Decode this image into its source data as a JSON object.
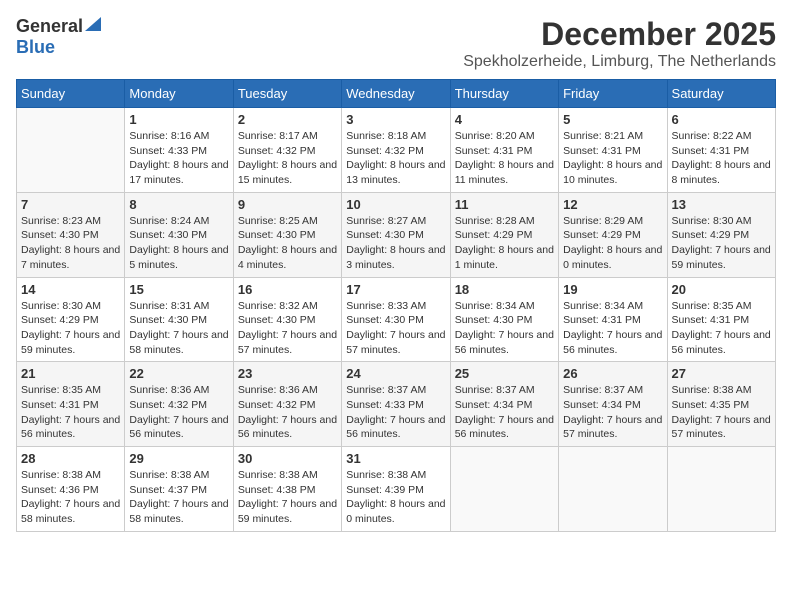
{
  "logo": {
    "general": "General",
    "blue": "Blue"
  },
  "title": "December 2025",
  "location": "Spekholzerheide, Limburg, The Netherlands",
  "weekdays": [
    "Sunday",
    "Monday",
    "Tuesday",
    "Wednesday",
    "Thursday",
    "Friday",
    "Saturday"
  ],
  "weeks": [
    [
      {
        "day": "",
        "sunrise": "",
        "sunset": "",
        "daylight": ""
      },
      {
        "day": "1",
        "sunrise": "Sunrise: 8:16 AM",
        "sunset": "Sunset: 4:33 PM",
        "daylight": "Daylight: 8 hours and 17 minutes."
      },
      {
        "day": "2",
        "sunrise": "Sunrise: 8:17 AM",
        "sunset": "Sunset: 4:32 PM",
        "daylight": "Daylight: 8 hours and 15 minutes."
      },
      {
        "day": "3",
        "sunrise": "Sunrise: 8:18 AM",
        "sunset": "Sunset: 4:32 PM",
        "daylight": "Daylight: 8 hours and 13 minutes."
      },
      {
        "day": "4",
        "sunrise": "Sunrise: 8:20 AM",
        "sunset": "Sunset: 4:31 PM",
        "daylight": "Daylight: 8 hours and 11 minutes."
      },
      {
        "day": "5",
        "sunrise": "Sunrise: 8:21 AM",
        "sunset": "Sunset: 4:31 PM",
        "daylight": "Daylight: 8 hours and 10 minutes."
      },
      {
        "day": "6",
        "sunrise": "Sunrise: 8:22 AM",
        "sunset": "Sunset: 4:31 PM",
        "daylight": "Daylight: 8 hours and 8 minutes."
      }
    ],
    [
      {
        "day": "7",
        "sunrise": "Sunrise: 8:23 AM",
        "sunset": "Sunset: 4:30 PM",
        "daylight": "Daylight: 8 hours and 7 minutes."
      },
      {
        "day": "8",
        "sunrise": "Sunrise: 8:24 AM",
        "sunset": "Sunset: 4:30 PM",
        "daylight": "Daylight: 8 hours and 5 minutes."
      },
      {
        "day": "9",
        "sunrise": "Sunrise: 8:25 AM",
        "sunset": "Sunset: 4:30 PM",
        "daylight": "Daylight: 8 hours and 4 minutes."
      },
      {
        "day": "10",
        "sunrise": "Sunrise: 8:27 AM",
        "sunset": "Sunset: 4:30 PM",
        "daylight": "Daylight: 8 hours and 3 minutes."
      },
      {
        "day": "11",
        "sunrise": "Sunrise: 8:28 AM",
        "sunset": "Sunset: 4:29 PM",
        "daylight": "Daylight: 8 hours and 1 minute."
      },
      {
        "day": "12",
        "sunrise": "Sunrise: 8:29 AM",
        "sunset": "Sunset: 4:29 PM",
        "daylight": "Daylight: 8 hours and 0 minutes."
      },
      {
        "day": "13",
        "sunrise": "Sunrise: 8:30 AM",
        "sunset": "Sunset: 4:29 PM",
        "daylight": "Daylight: 7 hours and 59 minutes."
      }
    ],
    [
      {
        "day": "14",
        "sunrise": "Sunrise: 8:30 AM",
        "sunset": "Sunset: 4:29 PM",
        "daylight": "Daylight: 7 hours and 59 minutes."
      },
      {
        "day": "15",
        "sunrise": "Sunrise: 8:31 AM",
        "sunset": "Sunset: 4:30 PM",
        "daylight": "Daylight: 7 hours and 58 minutes."
      },
      {
        "day": "16",
        "sunrise": "Sunrise: 8:32 AM",
        "sunset": "Sunset: 4:30 PM",
        "daylight": "Daylight: 7 hours and 57 minutes."
      },
      {
        "day": "17",
        "sunrise": "Sunrise: 8:33 AM",
        "sunset": "Sunset: 4:30 PM",
        "daylight": "Daylight: 7 hours and 57 minutes."
      },
      {
        "day": "18",
        "sunrise": "Sunrise: 8:34 AM",
        "sunset": "Sunset: 4:30 PM",
        "daylight": "Daylight: 7 hours and 56 minutes."
      },
      {
        "day": "19",
        "sunrise": "Sunrise: 8:34 AM",
        "sunset": "Sunset: 4:31 PM",
        "daylight": "Daylight: 7 hours and 56 minutes."
      },
      {
        "day": "20",
        "sunrise": "Sunrise: 8:35 AM",
        "sunset": "Sunset: 4:31 PM",
        "daylight": "Daylight: 7 hours and 56 minutes."
      }
    ],
    [
      {
        "day": "21",
        "sunrise": "Sunrise: 8:35 AM",
        "sunset": "Sunset: 4:31 PM",
        "daylight": "Daylight: 7 hours and 56 minutes."
      },
      {
        "day": "22",
        "sunrise": "Sunrise: 8:36 AM",
        "sunset": "Sunset: 4:32 PM",
        "daylight": "Daylight: 7 hours and 56 minutes."
      },
      {
        "day": "23",
        "sunrise": "Sunrise: 8:36 AM",
        "sunset": "Sunset: 4:32 PM",
        "daylight": "Daylight: 7 hours and 56 minutes."
      },
      {
        "day": "24",
        "sunrise": "Sunrise: 8:37 AM",
        "sunset": "Sunset: 4:33 PM",
        "daylight": "Daylight: 7 hours and 56 minutes."
      },
      {
        "day": "25",
        "sunrise": "Sunrise: 8:37 AM",
        "sunset": "Sunset: 4:34 PM",
        "daylight": "Daylight: 7 hours and 56 minutes."
      },
      {
        "day": "26",
        "sunrise": "Sunrise: 8:37 AM",
        "sunset": "Sunset: 4:34 PM",
        "daylight": "Daylight: 7 hours and 57 minutes."
      },
      {
        "day": "27",
        "sunrise": "Sunrise: 8:38 AM",
        "sunset": "Sunset: 4:35 PM",
        "daylight": "Daylight: 7 hours and 57 minutes."
      }
    ],
    [
      {
        "day": "28",
        "sunrise": "Sunrise: 8:38 AM",
        "sunset": "Sunset: 4:36 PM",
        "daylight": "Daylight: 7 hours and 58 minutes."
      },
      {
        "day": "29",
        "sunrise": "Sunrise: 8:38 AM",
        "sunset": "Sunset: 4:37 PM",
        "daylight": "Daylight: 7 hours and 58 minutes."
      },
      {
        "day": "30",
        "sunrise": "Sunrise: 8:38 AM",
        "sunset": "Sunset: 4:38 PM",
        "daylight": "Daylight: 7 hours and 59 minutes."
      },
      {
        "day": "31",
        "sunrise": "Sunrise: 8:38 AM",
        "sunset": "Sunset: 4:39 PM",
        "daylight": "Daylight: 8 hours and 0 minutes."
      },
      {
        "day": "",
        "sunrise": "",
        "sunset": "",
        "daylight": ""
      },
      {
        "day": "",
        "sunrise": "",
        "sunset": "",
        "daylight": ""
      },
      {
        "day": "",
        "sunrise": "",
        "sunset": "",
        "daylight": ""
      }
    ]
  ]
}
